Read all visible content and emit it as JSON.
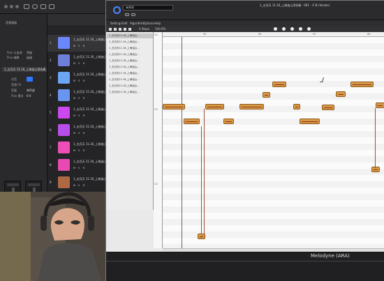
{
  "daw": {
    "sidebar": {
      "labels": [
        "音频通道",
        "Flex 与变调",
        "Flex 编辑",
        "试音",
        "音频 FX",
        "音量",
        "Flex 模式"
      ],
      "values": [
        "开启",
        "自动",
        "单声部",
        "0.0"
      ],
      "track_title": "1_五月天 11.16_上海油山顶合奏_001_-_千寻_(Vocals)",
      "buttons": [
        "M",
        "S",
        "R"
      ]
    },
    "toolbar_labels": [
      "编辑",
      "功能",
      "显示"
    ],
    "tracks": [
      {
        "number": "1",
        "name": "1_五月天 11.16_上海油山顶合奏",
        "color": "#6b87ff"
      },
      {
        "number": "2",
        "name": "1_五月天 11.16_上海油山顶合奏",
        "color": "#6f7fd9"
      },
      {
        "number": "3",
        "name": "1_五月天 11.16_上海油山顶合奏",
        "color": "#6da5f5"
      },
      {
        "number": "4",
        "name": "1_五月天 11.16_上海油山顶合奏",
        "color": "#6a95ee"
      },
      {
        "number": "5",
        "name": "1_五月天 11.16_上海油山顶合奏",
        "color": "#cb48ef"
      },
      {
        "number": "6",
        "name": "1_五月天 11.16_上海油山顶合奏",
        "color": "#b84ee9"
      },
      {
        "number": "7",
        "name": "1_五月天 11.16_上海油山顶合奏",
        "color": "#ef4eb6"
      },
      {
        "number": "8",
        "name": "1_五月天 11.16_上海油山顶合奏",
        "color": "#e84ab2"
      },
      {
        "number": "9",
        "name": "1_五月天 11.16_上海油山顶合奏",
        "color": "#af6844"
      }
    ],
    "track_buttons": [
      "M",
      "S",
      "R"
    ]
  },
  "melodyne": {
    "window_title": "1_五月天 11.16_上海油山顶合奏 - 001 - 千寻 (Vocals)",
    "dropdown": "未命名",
    "menus": [
      "Settings",
      "Edit",
      "Algorithm",
      "Options",
      "Help"
    ],
    "toolbar_fields": [
      "4 Steps",
      "100.0%"
    ],
    "track_list": [
      "1_五月天11.16_上海油山...",
      "1_五月天11.16_上海油山...",
      "1_五月天11.16_上海油山...",
      "1_五月天11.16_上海油山...",
      "1_五月天11.16_上海油山...",
      "1_五月天11.16_上海油山...",
      "1_五月天11.16_上海油山...",
      "1_五月天11.16_上海油山...",
      "1_五月天11.16_上海油山...",
      "1_五月天11.16_上海油山..."
    ],
    "ruler": [
      "65",
      "66",
      "67",
      "68"
    ],
    "pitch_labels": [
      "C4",
      "B",
      "A#",
      "A",
      "G#",
      "G",
      "F#",
      "F",
      "E",
      "D#",
      "D",
      "C#",
      "C3",
      "B",
      "A#",
      "A",
      "G#",
      "G",
      "F#",
      "F",
      "E",
      "D#",
      "D",
      "C#",
      "C2",
      "B",
      "A#",
      "A",
      "G#",
      "G"
    ],
    "footer": "Melodyne (ARA)"
  },
  "icons": {
    "power": "power-icon",
    "link": "link-icon",
    "playhead": "playhead-icon"
  },
  "colors": {
    "accent": "#4b86ff",
    "note": "#d89a44",
    "background": "#1b1b1c"
  }
}
